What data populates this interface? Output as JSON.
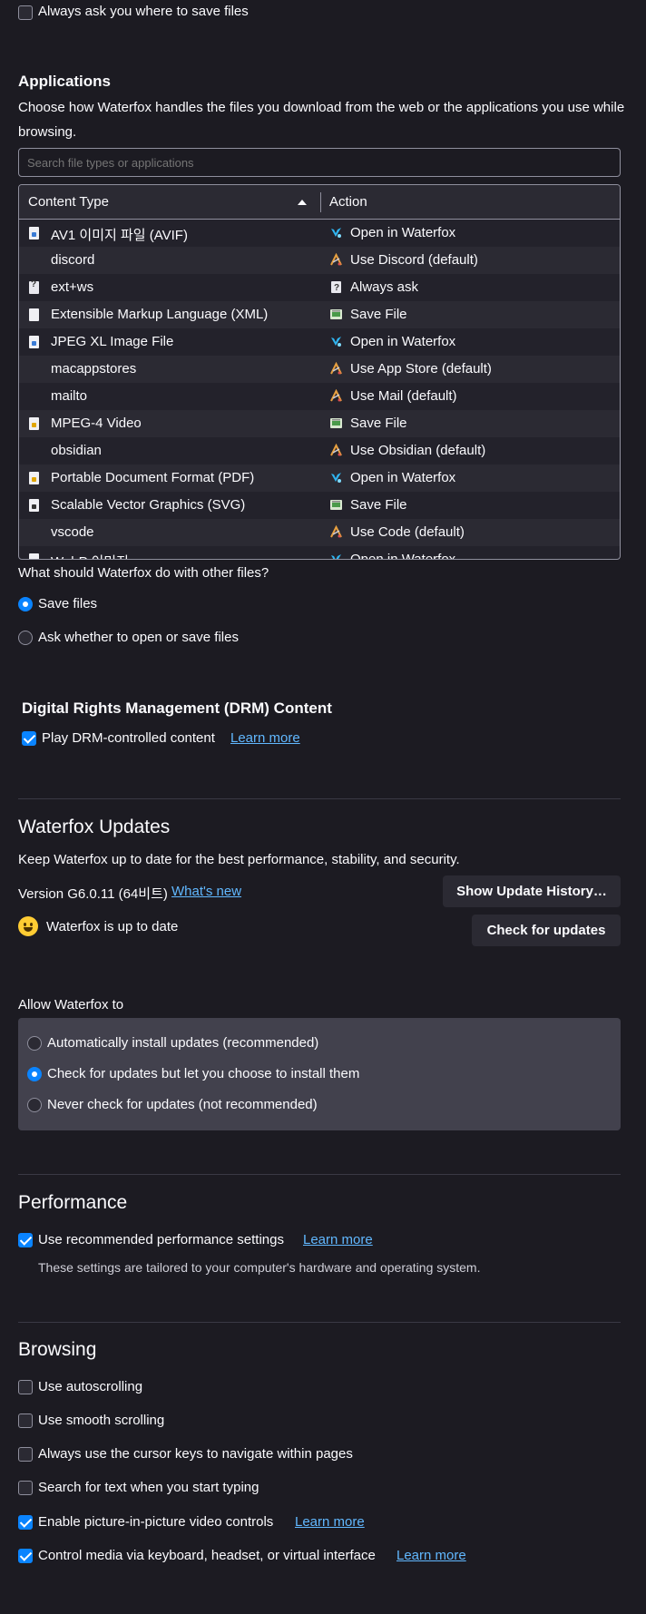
{
  "downloads": {
    "always_ask_label": "Always ask you where to save files",
    "always_ask_checked": false
  },
  "applications": {
    "heading": "Applications",
    "description": "Choose how Waterfox handles the files you download from the web or the applications you use while browsing.",
    "search_placeholder": "Search file types or applications",
    "columns": {
      "content_type": "Content Type",
      "action": "Action"
    },
    "rows": [
      {
        "type": "AV1 이미지 파일 (AVIF)",
        "type_icon": "image-file-icon",
        "action": "Open in Waterfox",
        "action_icon": "waterfox-icon"
      },
      {
        "type": "discord",
        "type_icon": "",
        "action": "Use Discord (default)",
        "action_icon": "app-icon"
      },
      {
        "type": "ext+ws",
        "type_icon": "question-file-icon",
        "action": "Always ask",
        "action_icon": "question-icon"
      },
      {
        "type": "Extensible Markup Language (XML)",
        "type_icon": "document-file-icon",
        "action": "Save File",
        "action_icon": "save-file-icon"
      },
      {
        "type": "JPEG XL Image File",
        "type_icon": "image-file-icon",
        "action": "Open in Waterfox",
        "action_icon": "waterfox-icon"
      },
      {
        "type": "macappstores",
        "type_icon": "",
        "action": "Use App Store (default)",
        "action_icon": "app-icon"
      },
      {
        "type": "mailto",
        "type_icon": "",
        "action": "Use Mail (default)",
        "action_icon": "app-icon"
      },
      {
        "type": "MPEG-4 Video",
        "type_icon": "video-file-icon",
        "action": "Save File",
        "action_icon": "save-file-icon"
      },
      {
        "type": "obsidian",
        "type_icon": "",
        "action": "Use Obsidian (default)",
        "action_icon": "app-icon"
      },
      {
        "type": "Portable Document Format (PDF)",
        "type_icon": "pdf-file-icon",
        "action": "Open in Waterfox",
        "action_icon": "waterfox-icon"
      },
      {
        "type": "Scalable Vector Graphics (SVG)",
        "type_icon": "svg-file-icon",
        "action": "Save File",
        "action_icon": "save-file-icon"
      },
      {
        "type": "vscode",
        "type_icon": "",
        "action": "Use Code (default)",
        "action_icon": "app-icon"
      },
      {
        "type": "WebP 이미지",
        "type_icon": "image-file-icon",
        "action": "Open in Waterfox",
        "action_icon": "waterfox-icon"
      }
    ],
    "other_files_question": "What should Waterfox do with other files?",
    "save_files_label": "Save files",
    "ask_open_save_label": "Ask whether to open or save files",
    "selected": "save"
  },
  "drm": {
    "heading": "Digital Rights Management (DRM) Content",
    "play_label": "Play DRM-controlled content",
    "learn_more": "Learn more",
    "checked": true
  },
  "updates": {
    "heading": "Waterfox Updates",
    "description": "Keep Waterfox up to date for the best performance, stability, and security.",
    "version": "Version G6.0.11 (64비트)",
    "whats_new": "What's new",
    "history_button": "Show Update History…",
    "status": "Waterfox is up to date",
    "check_button": "Check for updates",
    "allow_label": "Allow Waterfox to",
    "options": [
      "Automatically install updates (recommended)",
      "Check for updates but let you choose to install them",
      "Never check for updates (not recommended)"
    ],
    "selected_index": 1
  },
  "performance": {
    "heading": "Performance",
    "recommended_label": "Use recommended performance settings",
    "learn_more": "Learn more",
    "note": "These settings are tailored to your computer's hardware and operating system.",
    "checked": true
  },
  "browsing": {
    "heading": "Browsing",
    "options": [
      {
        "label": "Use autoscrolling",
        "checked": false
      },
      {
        "label": "Use smooth scrolling",
        "checked": false
      },
      {
        "label": "Always use the cursor keys to navigate within pages",
        "checked": false
      },
      {
        "label": "Search for text when you start typing",
        "checked": false
      },
      {
        "label": "Enable picture-in-picture video controls",
        "checked": true,
        "learn_more": "Learn more"
      },
      {
        "label": "Control media via keyboard, headset, or virtual interface",
        "checked": true,
        "learn_more": "Learn more"
      }
    ]
  },
  "colors": {
    "background": "#1c1b22",
    "accent": "#0a84ff",
    "link": "#61b8ff",
    "panel": "#42414d"
  }
}
